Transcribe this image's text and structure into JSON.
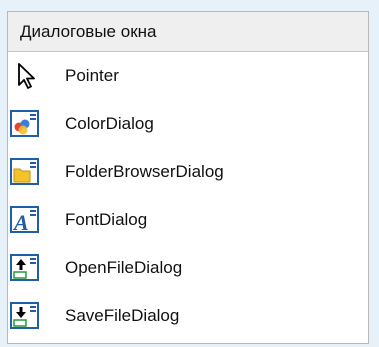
{
  "toolbox": {
    "header": "Диалоговые окна",
    "items": [
      {
        "label": "Pointer",
        "icon": "pointer-arrow-icon"
      },
      {
        "label": "ColorDialog",
        "icon": "color-dialog-icon"
      },
      {
        "label": "FolderBrowserDialog",
        "icon": "folder-browser-dialog-icon"
      },
      {
        "label": "FontDialog",
        "icon": "font-dialog-icon"
      },
      {
        "label": "OpenFileDialog",
        "icon": "open-file-dialog-icon"
      },
      {
        "label": "SaveFileDialog",
        "icon": "save-file-dialog-icon"
      }
    ]
  },
  "colors": {
    "background": "#e6f1f9",
    "header_bg": "#efefef",
    "icon_frame": "#1f5fa8",
    "folder_yellow": "#f5c22b"
  }
}
